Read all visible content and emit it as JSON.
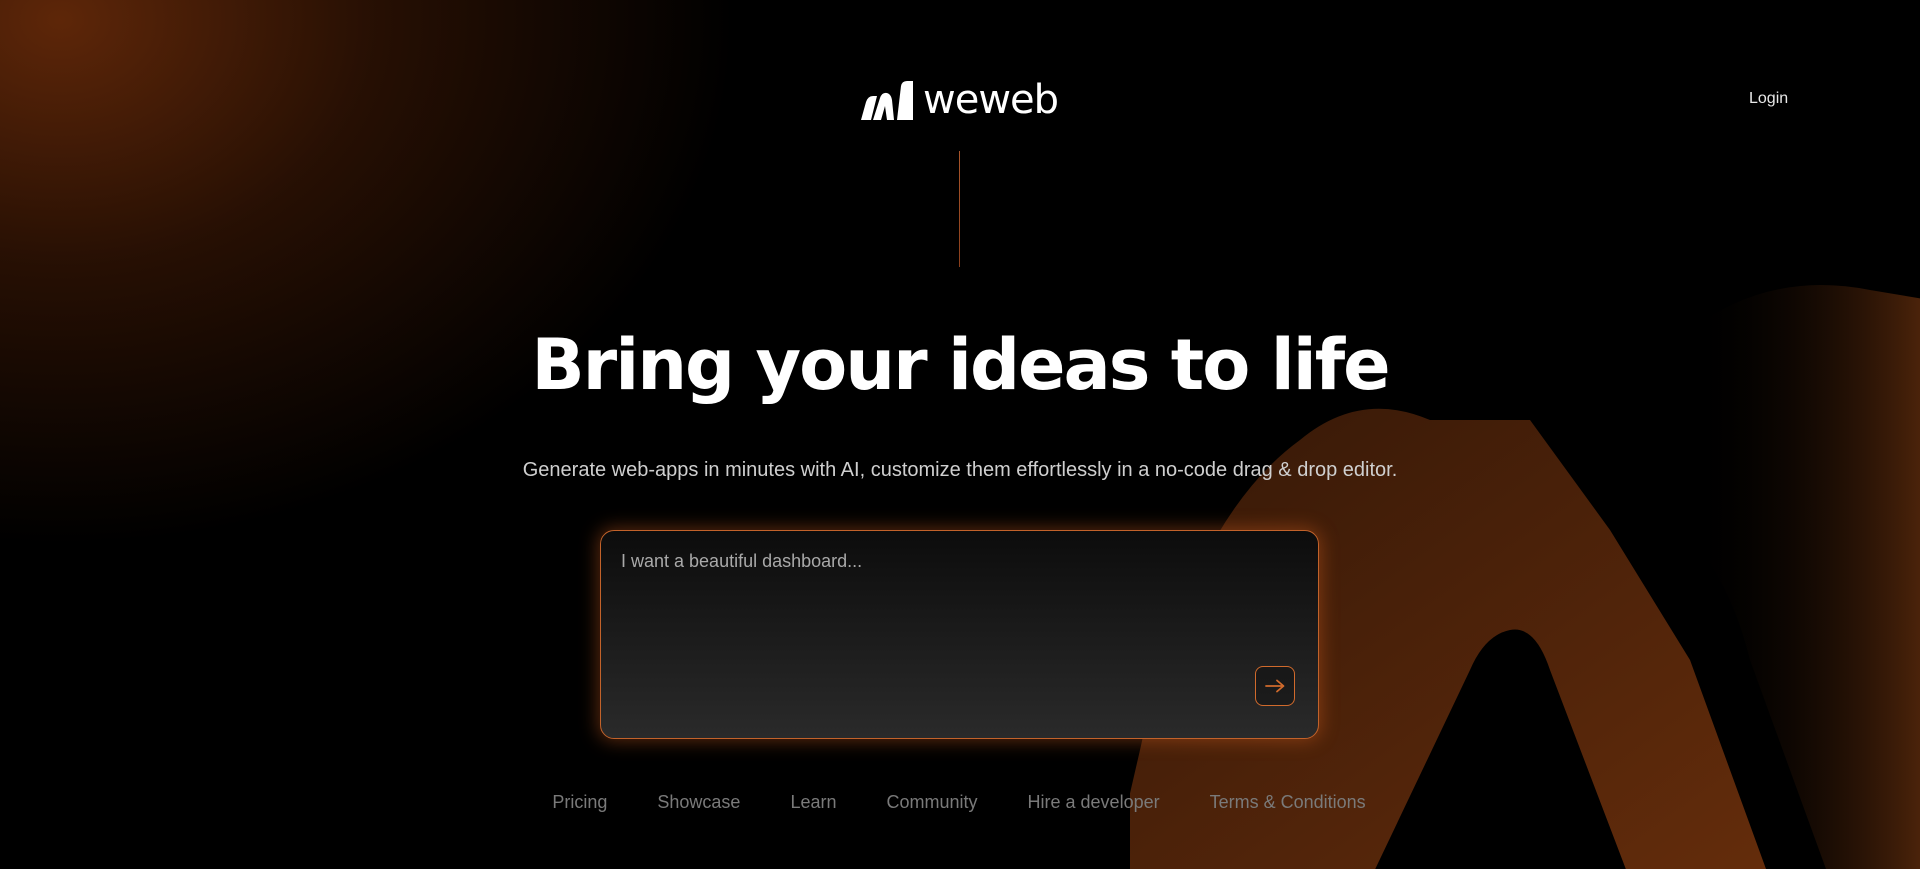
{
  "brand": {
    "name": "weweb",
    "logo_icon": "weweb-logo-icon",
    "accent_color": "#d06a2c"
  },
  "header": {
    "login_label": "Login"
  },
  "hero": {
    "title": "Bring your ideas to life",
    "subtitle": "Generate web-apps in minutes with AI, customize them effortlessly in a no-code drag & drop editor."
  },
  "prompt": {
    "placeholder": "I want a beautiful dashboard...",
    "value": "",
    "submit_icon": "arrow-right-icon"
  },
  "footer": {
    "links": [
      {
        "label": "Pricing"
      },
      {
        "label": "Showcase"
      },
      {
        "label": "Learn"
      },
      {
        "label": "Community"
      },
      {
        "label": "Hire a developer"
      },
      {
        "label": "Terms & Conditions"
      }
    ]
  }
}
